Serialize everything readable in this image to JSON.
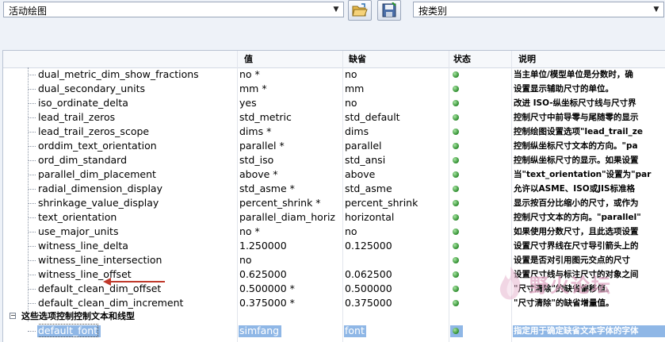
{
  "toolbar": {
    "left_combo_value": "活动绘图",
    "right_combo_value": "按类别",
    "open_button_icon": "folder-open-icon",
    "save_button_icon": "save-icon"
  },
  "columns": {
    "name": "",
    "value": "值",
    "default": "缺省",
    "status": "状态",
    "description": "说明"
  },
  "rows": [
    {
      "name": "dual_metric_dim_show_fractions",
      "value": "no *",
      "default": "no",
      "description": "当主单位/模型单位是分数时，确"
    },
    {
      "name": "dual_secondary_units",
      "value": "mm *",
      "default": "mm",
      "description": "设置显示辅助尺寸的单位。"
    },
    {
      "name": "iso_ordinate_delta",
      "value": "yes",
      "default": "no",
      "description": "改进 ISO-纵坐标尺寸线与尺寸界"
    },
    {
      "name": "lead_trail_zeros",
      "value": "std_metric",
      "default": "std_default",
      "description": "控制尺寸中前导零与尾随零的显示"
    },
    {
      "name": "lead_trail_zeros_scope",
      "value": "dims *",
      "default": "dims",
      "description": "控制绘图设置选项\"lead_trail_ze"
    },
    {
      "name": "orddim_text_orientation",
      "value": "parallel *",
      "default": "parallel",
      "description": "控制纵坐标尺寸文本的方向。\"pa"
    },
    {
      "name": "ord_dim_standard",
      "value": "std_iso",
      "default": "std_ansi",
      "description": "控制纵坐标尺寸的显示。如果设置"
    },
    {
      "name": "parallel_dim_placement",
      "value": "above *",
      "default": "above",
      "description": "当\"text_orientation\"设置为\"par"
    },
    {
      "name": "radial_dimension_display",
      "value": "std_asme *",
      "default": "std_asme",
      "description": "允许以ASME、ISO或JIS标准格"
    },
    {
      "name": "shrinkage_value_display",
      "value": "percent_shrink *",
      "default": "percent_shrink",
      "description": "显示按百分比缩小的尺寸，或作为"
    },
    {
      "name": "text_orientation",
      "value": "parallel_diam_horiz",
      "default": "horizontal",
      "description": "控制尺寸文本的方向。\"parallel\""
    },
    {
      "name": "use_major_units",
      "value": "no *",
      "default": "no",
      "description": "如果使用分数尺寸，且此选项设置"
    },
    {
      "name": "witness_line_delta",
      "value": "1.250000",
      "default": "0.125000",
      "description": "设置尺寸界线在尺寸导引箭头上的"
    },
    {
      "name": "witness_line_intersection",
      "value": "no",
      "default": "",
      "description": "设置是否对引用图元交点的尺寸"
    },
    {
      "name": "witness_line_offset",
      "value": "0.625000",
      "default": "0.062500",
      "description": "设置尺寸线与标注尺寸的对象之间"
    },
    {
      "name": "default_clean_dim_offset",
      "value": "0.500000 *",
      "default": "0.500000",
      "description": "\"尺寸清除\"的缺省偏移值。"
    },
    {
      "name": "default_clean_dim_increment",
      "value": "0.375000 *",
      "default": "0.375000",
      "description": "\"尺寸清除\"的缺省增量值。"
    }
  ],
  "group": {
    "expander": "−",
    "label": "这些选项控制控制文本和线型"
  },
  "selected_row": {
    "name": "default_font",
    "value": "simfang",
    "default": "font",
    "description": "指定用于确定缺省文本字体的字体"
  },
  "watermark": {
    "text": "野火论坛"
  },
  "colors": {
    "status_green": "#2e8c2e",
    "selection": "#8fb7e6",
    "arrow": "#c0392b",
    "watermark": "#e0a8c4"
  }
}
